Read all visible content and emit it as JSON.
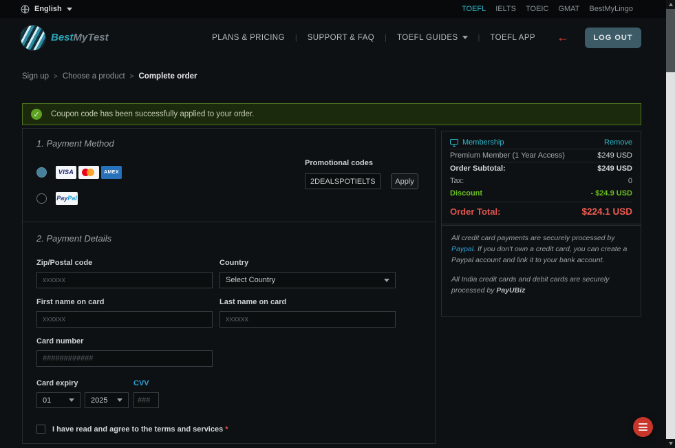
{
  "colors": {
    "accent": "#2eb8c9",
    "success": "#69bd21",
    "danger": "#e0544e",
    "alert_border": "#50771f"
  },
  "topbar": {
    "language_label": "English",
    "links": [
      "TOEFL",
      "IELTS",
      "TOEIC",
      "GMAT",
      "BestMyLingo"
    ]
  },
  "header": {
    "brand_first": "Best",
    "brand_second": "MyTest",
    "nav": [
      "PLANS & PRICING",
      "SUPPORT & FAQ",
      "TOEFL GUIDES",
      "TOEFL APP"
    ],
    "nav_separator": "|",
    "back_arrow": "←",
    "logout_label": "LOG OUT"
  },
  "breadcrumb": {
    "separator": ">",
    "items": [
      "Sign up",
      "Choose a product",
      "Complete order"
    ]
  },
  "alert": {
    "check": "✓",
    "message": "Coupon code has been successfully applied to your order."
  },
  "payment_method": {
    "title": "1. Payment Method",
    "icons": {
      "visa": "VISA",
      "amex": "AMEX",
      "paypal_pay": "Pay",
      "paypal_pal": "Pal"
    },
    "promo": {
      "label": "Promotional codes",
      "value": "2DEALSPOTIELTS",
      "apply_label": "Apply"
    }
  },
  "payment_details": {
    "title": "2. Payment Details",
    "zip": {
      "label": "Zip/Postal code",
      "placeholder": "xxxxxx"
    },
    "country": {
      "label": "Country",
      "value": "Select Country"
    },
    "first_name": {
      "label": "First name on card",
      "placeholder": "xxxxxx"
    },
    "last_name": {
      "label": "Last name on card",
      "placeholder": "xxxxxx"
    },
    "card_number": {
      "label": "Card number",
      "placeholder": "############"
    },
    "expiry": {
      "label": "Card expiry",
      "month": "01",
      "year": "2025"
    },
    "cvv": {
      "label": "CVV",
      "placeholder": "###"
    },
    "terms": {
      "text": "I have read and agree to the terms and services",
      "required_mark": "*"
    }
  },
  "order_summary": {
    "title": "Membership",
    "remove_label": "Remove",
    "item": {
      "label": "Premium Member (1 Year Access)",
      "price": "$249 USD"
    },
    "subtotal": {
      "label": "Order Subtotal:",
      "value": "$249 USD"
    },
    "tax": {
      "label": "Tax:",
      "value": "0"
    },
    "discount": {
      "label": "Discount",
      "value": "- $24.9 USD"
    },
    "total": {
      "label": "Order Total:",
      "value": "$224.1 USD"
    }
  },
  "notes": {
    "p1_before": "All credit card payments are securely processed by ",
    "p1_link": "Paypal",
    "p1_after": ". If you don't own a credit card, you can create a Paypal account and link it to your bank account.",
    "p2_text": "All India credit cards and debit cards are securely processed by ",
    "p2_brand": "PayUBiz"
  }
}
